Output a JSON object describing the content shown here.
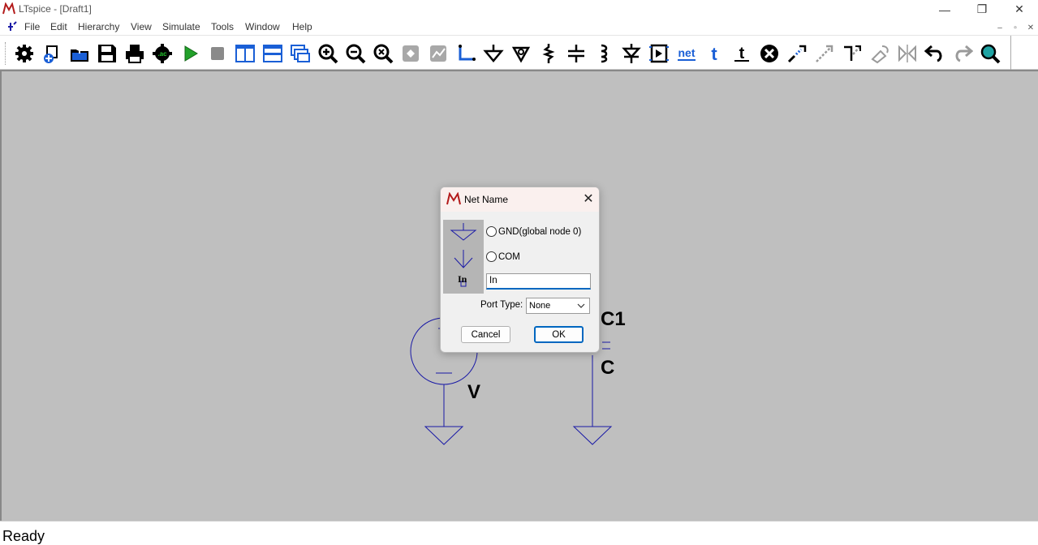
{
  "window": {
    "title": "LTspice - [Draft1]",
    "minimize_glyph": "—",
    "restore_glyph": "❐",
    "close_glyph": "✕"
  },
  "menubar": {
    "items": [
      "File",
      "Edit",
      "Hierarchy",
      "View",
      "Simulate",
      "Tools",
      "Window",
      "Help"
    ],
    "mdi_min": "–",
    "mdi_restore": "▫",
    "mdi_close": "✕"
  },
  "toolbar": {
    "icons": [
      "settings-icon",
      "new-schematic-icon",
      "open-icon",
      "save-icon",
      "print-icon",
      "control-panel-icon",
      "run-icon",
      "halt-icon",
      "tile-vertical-icon",
      "tile-horizontal-icon",
      "cascade-icon",
      "zoom-in-icon",
      "zoom-out-icon",
      "zoom-fit-icon",
      "pan-icon",
      "autorange-icon",
      "wire-icon",
      "ground-icon",
      "label-net-icon",
      "resistor-icon",
      "capacitor-icon",
      "inductor-icon",
      "diode-icon",
      "component-icon",
      "spice-directive-net-icon",
      "text-icon",
      "spice-directive-icon",
      "delete-icon",
      "duplicate-icon",
      "move-icon",
      "drag-icon",
      "rotate-icon",
      "mirror-icon",
      "undo-icon",
      "redo-icon",
      "find-icon"
    ],
    "net_text": "net",
    "t_text": "t"
  },
  "schematic": {
    "labels": {
      "voltage_source": "V",
      "cap_name": "C1",
      "cap_value": "C"
    },
    "wire_color": "#1a1aa6"
  },
  "dialog": {
    "title": "Net Name",
    "close": "✕",
    "preview_label": "In",
    "options": [
      "GND(global node 0)",
      "COM"
    ],
    "net_name_value": "In",
    "port_type_label": "Port Type:",
    "port_type_value": "None",
    "cancel_label": "Cancel",
    "ok_label": "OK"
  },
  "status": {
    "text": "Ready"
  }
}
